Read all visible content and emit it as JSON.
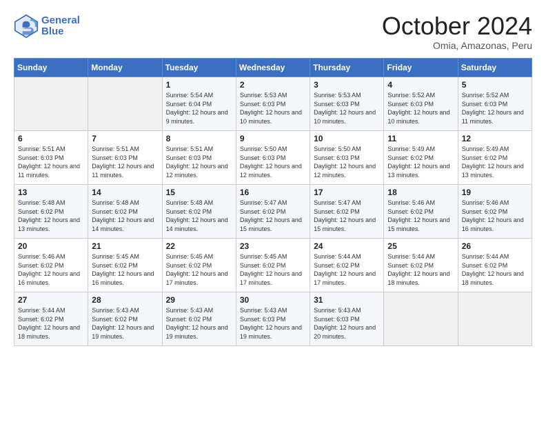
{
  "header": {
    "logo_line1": "General",
    "logo_line2": "Blue",
    "month": "October 2024",
    "location": "Omia, Amazonas, Peru"
  },
  "weekdays": [
    "Sunday",
    "Monday",
    "Tuesday",
    "Wednesday",
    "Thursday",
    "Friday",
    "Saturday"
  ],
  "weeks": [
    [
      {
        "day": "",
        "sunrise": "",
        "sunset": "",
        "daylight": ""
      },
      {
        "day": "",
        "sunrise": "",
        "sunset": "",
        "daylight": ""
      },
      {
        "day": "1",
        "sunrise": "Sunrise: 5:54 AM",
        "sunset": "Sunset: 6:04 PM",
        "daylight": "Daylight: 12 hours and 9 minutes."
      },
      {
        "day": "2",
        "sunrise": "Sunrise: 5:53 AM",
        "sunset": "Sunset: 6:03 PM",
        "daylight": "Daylight: 12 hours and 10 minutes."
      },
      {
        "day": "3",
        "sunrise": "Sunrise: 5:53 AM",
        "sunset": "Sunset: 6:03 PM",
        "daylight": "Daylight: 12 hours and 10 minutes."
      },
      {
        "day": "4",
        "sunrise": "Sunrise: 5:52 AM",
        "sunset": "Sunset: 6:03 PM",
        "daylight": "Daylight: 12 hours and 10 minutes."
      },
      {
        "day": "5",
        "sunrise": "Sunrise: 5:52 AM",
        "sunset": "Sunset: 6:03 PM",
        "daylight": "Daylight: 12 hours and 11 minutes."
      }
    ],
    [
      {
        "day": "6",
        "sunrise": "Sunrise: 5:51 AM",
        "sunset": "Sunset: 6:03 PM",
        "daylight": "Daylight: 12 hours and 11 minutes."
      },
      {
        "day": "7",
        "sunrise": "Sunrise: 5:51 AM",
        "sunset": "Sunset: 6:03 PM",
        "daylight": "Daylight: 12 hours and 11 minutes."
      },
      {
        "day": "8",
        "sunrise": "Sunrise: 5:51 AM",
        "sunset": "Sunset: 6:03 PM",
        "daylight": "Daylight: 12 hours and 12 minutes."
      },
      {
        "day": "9",
        "sunrise": "Sunrise: 5:50 AM",
        "sunset": "Sunset: 6:03 PM",
        "daylight": "Daylight: 12 hours and 12 minutes."
      },
      {
        "day": "10",
        "sunrise": "Sunrise: 5:50 AM",
        "sunset": "Sunset: 6:03 PM",
        "daylight": "Daylight: 12 hours and 12 minutes."
      },
      {
        "day": "11",
        "sunrise": "Sunrise: 5:49 AM",
        "sunset": "Sunset: 6:02 PM",
        "daylight": "Daylight: 12 hours and 13 minutes."
      },
      {
        "day": "12",
        "sunrise": "Sunrise: 5:49 AM",
        "sunset": "Sunset: 6:02 PM",
        "daylight": "Daylight: 12 hours and 13 minutes."
      }
    ],
    [
      {
        "day": "13",
        "sunrise": "Sunrise: 5:48 AM",
        "sunset": "Sunset: 6:02 PM",
        "daylight": "Daylight: 12 hours and 13 minutes."
      },
      {
        "day": "14",
        "sunrise": "Sunrise: 5:48 AM",
        "sunset": "Sunset: 6:02 PM",
        "daylight": "Daylight: 12 hours and 14 minutes."
      },
      {
        "day": "15",
        "sunrise": "Sunrise: 5:48 AM",
        "sunset": "Sunset: 6:02 PM",
        "daylight": "Daylight: 12 hours and 14 minutes."
      },
      {
        "day": "16",
        "sunrise": "Sunrise: 5:47 AM",
        "sunset": "Sunset: 6:02 PM",
        "daylight": "Daylight: 12 hours and 15 minutes."
      },
      {
        "day": "17",
        "sunrise": "Sunrise: 5:47 AM",
        "sunset": "Sunset: 6:02 PM",
        "daylight": "Daylight: 12 hours and 15 minutes."
      },
      {
        "day": "18",
        "sunrise": "Sunrise: 5:46 AM",
        "sunset": "Sunset: 6:02 PM",
        "daylight": "Daylight: 12 hours and 15 minutes."
      },
      {
        "day": "19",
        "sunrise": "Sunrise: 5:46 AM",
        "sunset": "Sunset: 6:02 PM",
        "daylight": "Daylight: 12 hours and 16 minutes."
      }
    ],
    [
      {
        "day": "20",
        "sunrise": "Sunrise: 5:46 AM",
        "sunset": "Sunset: 6:02 PM",
        "daylight": "Daylight: 12 hours and 16 minutes."
      },
      {
        "day": "21",
        "sunrise": "Sunrise: 5:45 AM",
        "sunset": "Sunset: 6:02 PM",
        "daylight": "Daylight: 12 hours and 16 minutes."
      },
      {
        "day": "22",
        "sunrise": "Sunrise: 5:45 AM",
        "sunset": "Sunset: 6:02 PM",
        "daylight": "Daylight: 12 hours and 17 minutes."
      },
      {
        "day": "23",
        "sunrise": "Sunrise: 5:45 AM",
        "sunset": "Sunset: 6:02 PM",
        "daylight": "Daylight: 12 hours and 17 minutes."
      },
      {
        "day": "24",
        "sunrise": "Sunrise: 5:44 AM",
        "sunset": "Sunset: 6:02 PM",
        "daylight": "Daylight: 12 hours and 17 minutes."
      },
      {
        "day": "25",
        "sunrise": "Sunrise: 5:44 AM",
        "sunset": "Sunset: 6:02 PM",
        "daylight": "Daylight: 12 hours and 18 minutes."
      },
      {
        "day": "26",
        "sunrise": "Sunrise: 5:44 AM",
        "sunset": "Sunset: 6:02 PM",
        "daylight": "Daylight: 12 hours and 18 minutes."
      }
    ],
    [
      {
        "day": "27",
        "sunrise": "Sunrise: 5:44 AM",
        "sunset": "Sunset: 6:02 PM",
        "daylight": "Daylight: 12 hours and 18 minutes."
      },
      {
        "day": "28",
        "sunrise": "Sunrise: 5:43 AM",
        "sunset": "Sunset: 6:02 PM",
        "daylight": "Daylight: 12 hours and 19 minutes."
      },
      {
        "day": "29",
        "sunrise": "Sunrise: 5:43 AM",
        "sunset": "Sunset: 6:02 PM",
        "daylight": "Daylight: 12 hours and 19 minutes."
      },
      {
        "day": "30",
        "sunrise": "Sunrise: 5:43 AM",
        "sunset": "Sunset: 6:03 PM",
        "daylight": "Daylight: 12 hours and 19 minutes."
      },
      {
        "day": "31",
        "sunrise": "Sunrise: 5:43 AM",
        "sunset": "Sunset: 6:03 PM",
        "daylight": "Daylight: 12 hours and 20 minutes."
      },
      {
        "day": "",
        "sunrise": "",
        "sunset": "",
        "daylight": ""
      },
      {
        "day": "",
        "sunrise": "",
        "sunset": "",
        "daylight": ""
      }
    ]
  ]
}
